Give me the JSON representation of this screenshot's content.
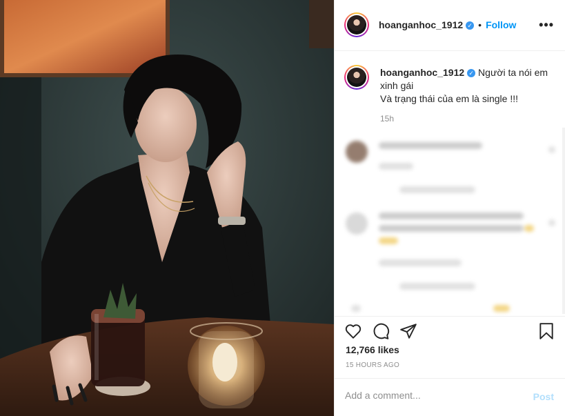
{
  "post": {
    "author": {
      "username": "hoanganhoc_1912",
      "verified_badge": "✓",
      "separator": "•",
      "follow_label": "Follow"
    },
    "more_options": "•••",
    "caption": {
      "username": "hoanganhoc_1912",
      "text_line1": "Người ta nói em xinh gái",
      "text_line2": "Và trạng thái của em là single !!!",
      "time": "15h"
    },
    "actions": {
      "like_icon": "heart-icon",
      "comment_icon": "comment-icon",
      "share_icon": "share-icon",
      "save_icon": "bookmark-icon"
    },
    "likes": "12,766 likes",
    "timestamp": "15 HOURS AGO",
    "comment_box": {
      "placeholder": "Add a comment...",
      "post_label": "Post"
    },
    "colors": {
      "accent": "#0095f6",
      "post_disabled": "#b2dffc",
      "muted": "#8e8e8e"
    }
  }
}
